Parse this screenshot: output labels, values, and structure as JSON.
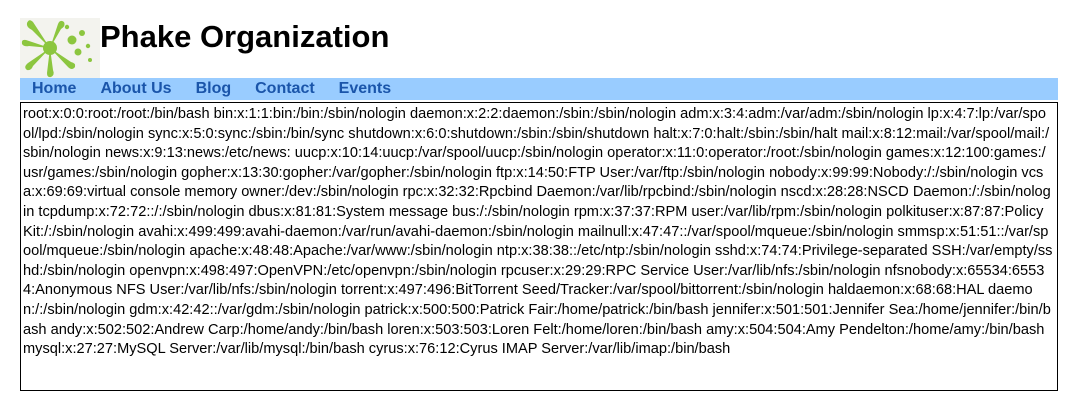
{
  "header": {
    "title": "Phake Organization"
  },
  "nav": {
    "items": [
      "Home",
      "About Us",
      "Blog",
      "Contact",
      "Events"
    ]
  },
  "content": {
    "text": "root:x:0:0:root:/root:/bin/bash bin:x:1:1:bin:/bin:/sbin/nologin daemon:x:2:2:daemon:/sbin:/sbin/nologin adm:x:3:4:adm:/var/adm:/sbin/nologin lp:x:4:7:lp:/var/spool/lpd:/sbin/nologin sync:x:5:0:sync:/sbin:/bin/sync shutdown:x:6:0:shutdown:/sbin:/sbin/shutdown halt:x:7:0:halt:/sbin:/sbin/halt mail:x:8:12:mail:/var/spool/mail:/sbin/nologin news:x:9:13:news:/etc/news: uucp:x:10:14:uucp:/var/spool/uucp:/sbin/nologin operator:x:11:0:operator:/root:/sbin/nologin games:x:12:100:games:/usr/games:/sbin/nologin gopher:x:13:30:gopher:/var/gopher:/sbin/nologin ftp:x:14:50:FTP User:/var/ftp:/sbin/nologin nobody:x:99:99:Nobody:/:/sbin/nologin vcsa:x:69:69:virtual console memory owner:/dev:/sbin/nologin rpc:x:32:32:Rpcbind Daemon:/var/lib/rpcbind:/sbin/nologin nscd:x:28:28:NSCD Daemon:/:/sbin/nologin tcpdump:x:72:72::/:/sbin/nologin dbus:x:81:81:System message bus:/:/sbin/nologin rpm:x:37:37:RPM user:/var/lib/rpm:/sbin/nologin polkituser:x:87:87:PolicyKit:/:/sbin/nologin avahi:x:499:499:avahi-daemon:/var/run/avahi-daemon:/sbin/nologin mailnull:x:47:47::/var/spool/mqueue:/sbin/nologin smmsp:x:51:51::/var/spool/mqueue:/sbin/nologin apache:x:48:48:Apache:/var/www:/sbin/nologin ntp:x:38:38::/etc/ntp:/sbin/nologin sshd:x:74:74:Privilege-separated SSH:/var/empty/sshd:/sbin/nologin openvpn:x:498:497:OpenVPN:/etc/openvpn:/sbin/nologin rpcuser:x:29:29:RPC Service User:/var/lib/nfs:/sbin/nologin nfsnobody:x:65534:65534:Anonymous NFS User:/var/lib/nfs:/sbin/nologin torrent:x:497:496:BitTorrent Seed/Tracker:/var/spool/bittorrent:/sbin/nologin haldaemon:x:68:68:HAL daemon:/:/sbin/nologin gdm:x:42:42::/var/gdm:/sbin/nologin patrick:x:500:500:Patrick Fair:/home/patrick:/bin/bash jennifer:x:501:501:Jennifer Sea:/home/jennifer:/bin/bash andy:x:502:502:Andrew Carp:/home/andy:/bin/bash loren:x:503:503:Loren Felt:/home/loren:/bin/bash amy:x:504:504:Amy Pendelton:/home/amy:/bin/bash mysql:x:27:27:MySQL Server:/var/lib/mysql:/bin/bash cyrus:x:76:12:Cyrus IMAP Server:/var/lib/imap:/bin/bash"
  },
  "colors": {
    "nav_background": "#99ccff",
    "nav_link": "#1a55aa",
    "logo_green": "#8cc63f"
  },
  "icons": {
    "logo": "green-splat-logo-icon"
  }
}
